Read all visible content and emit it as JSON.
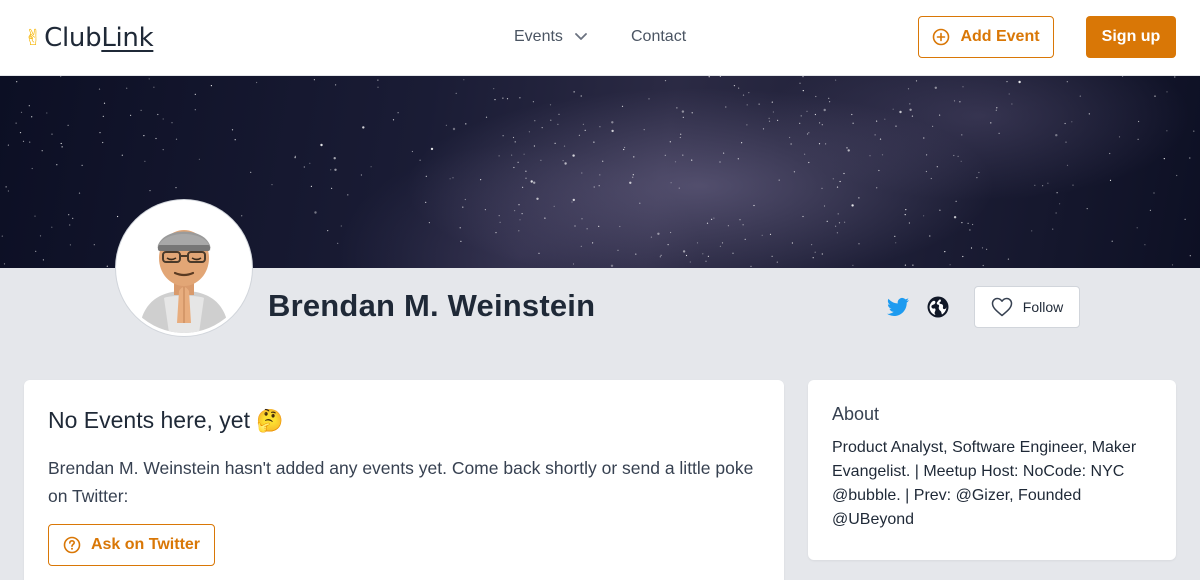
{
  "header": {
    "logo_icon": "victory-hand-emoji",
    "logo_text_plain": "Club",
    "logo_text_link": "Link",
    "nav_events_label": "Events",
    "nav_contact_label": "Contact",
    "add_event_label": "Add Event",
    "sign_up_label": "Sign up"
  },
  "profile": {
    "name": "Brendan M. Weinstein",
    "avatar_icon": "memoji-avatar",
    "follow_label": "Follow",
    "social_icons": [
      "twitter-icon",
      "globe-icon"
    ]
  },
  "events_card": {
    "title": "No Events here, yet",
    "title_emoji": "🤔",
    "description": "Brendan M. Weinstein hasn't added any events yet. Come back shortly or send a little poke on Twitter:",
    "ask_button_label": "Ask on Twitter"
  },
  "about_card": {
    "heading": "About",
    "bio": "Product Analyst, Software Engineer, Maker Evangelist. | Meetup Host: NoCode: NYC @bubble. | Prev: @Gizer, Founded @UBeyond"
  },
  "colors": {
    "accent": "#d97706",
    "twitter": "#1d9bf0",
    "page_background": "#e5e7eb",
    "text_primary": "#1f2937"
  }
}
